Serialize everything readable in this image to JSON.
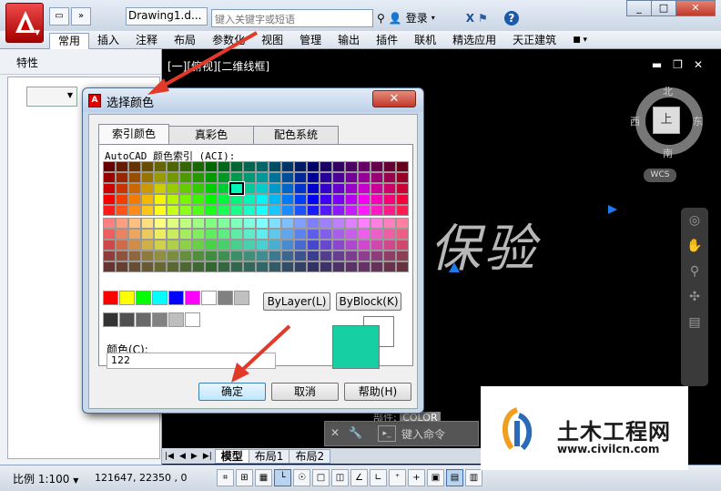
{
  "titlebar": {
    "doc_title": "Drawing1.d...",
    "search_placeholder": "键入关键字或短语",
    "login": "登录",
    "help": "?",
    "qat_new": "",
    "qat_more": "»"
  },
  "ribbon_tabs": [
    "常用",
    "插入",
    "注释",
    "布局",
    "参数化",
    "视图",
    "管理",
    "输出",
    "插件",
    "联机",
    "精选应用",
    "天正建筑"
  ],
  "props": {
    "title": "特性"
  },
  "viewport": {
    "label": "[一][俯视][二维线框]",
    "north": "北",
    "south": "南",
    "east": "东",
    "west": "西",
    "top": "上",
    "wcs": "WCS",
    "handwriting": "保验"
  },
  "command": {
    "placeholder": "键入命令",
    "prefix": "部件:",
    "color_tag": "COLOR"
  },
  "layout_tabs": [
    "模型",
    "布局1",
    "布局2"
  ],
  "status": {
    "scale": "比例 1:100",
    "coords": "121647, 22350 , 0"
  },
  "dialog": {
    "title": "选择颜色",
    "tabs": [
      "索引颜色",
      "真彩色",
      "配色系统"
    ],
    "aci_label": "AutoCAD 颜色索引 (ACI):",
    "bylayer": "ByLayer(L)",
    "byblock": "ByBlock(K)",
    "color_label": "颜色(C):",
    "color_value": "122",
    "ok": "确定",
    "cancel": "取消",
    "help": "帮助(H)",
    "new_color": "#16cfa3"
  },
  "watermark": {
    "name": "土木工程网",
    "url": "www.civilcn.com"
  }
}
